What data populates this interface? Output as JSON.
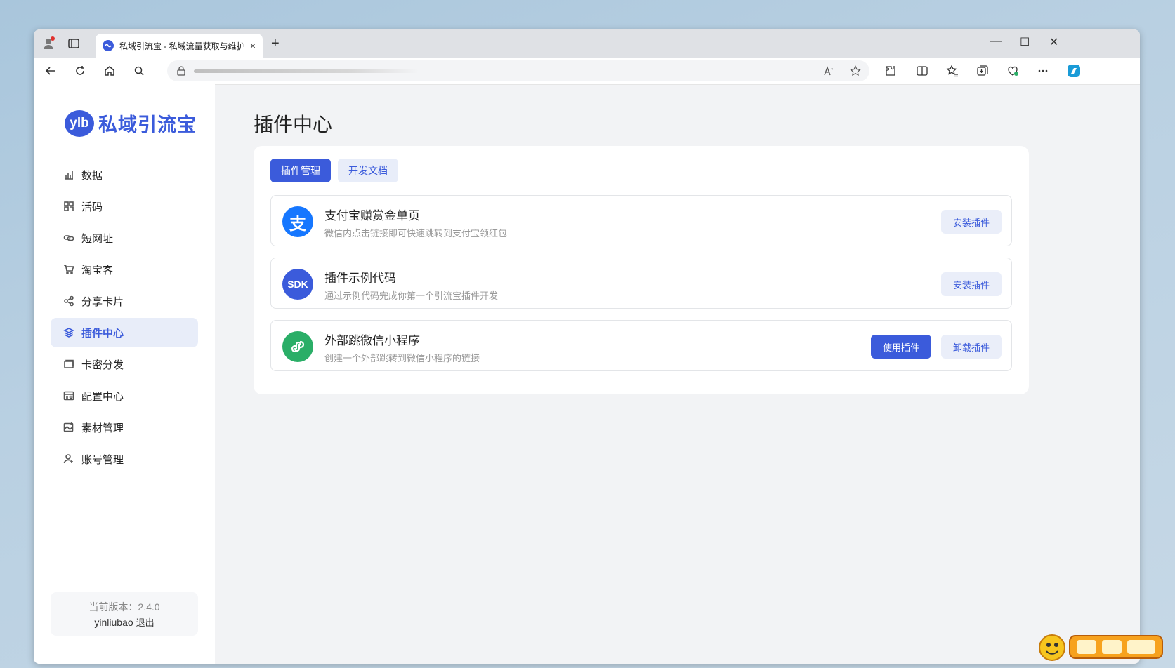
{
  "browser": {
    "tab_title": "私域引流宝 - 私域流量获取与维护",
    "new_tab_symbol": "+",
    "close_symbol": "×",
    "minimize_symbol": "—",
    "maximize_symbol": "☐",
    "window_close_symbol": "✕"
  },
  "app": {
    "logo_badge": "ylb",
    "logo_name": "私域引流宝",
    "accent_color": "#3b5bdb"
  },
  "sidebar": {
    "items": [
      {
        "label": "数据",
        "icon": "bar-chart-icon"
      },
      {
        "label": "活码",
        "icon": "grid-icon"
      },
      {
        "label": "短网址",
        "icon": "link-icon"
      },
      {
        "label": "淘宝客",
        "icon": "cart-icon"
      },
      {
        "label": "分享卡片",
        "icon": "share-icon"
      },
      {
        "label": "插件中心",
        "icon": "layers-icon",
        "active": true
      },
      {
        "label": "卡密分发",
        "icon": "card-icon"
      },
      {
        "label": "配置中心",
        "icon": "config-icon"
      },
      {
        "label": "素材管理",
        "icon": "image-icon"
      },
      {
        "label": "账号管理",
        "icon": "user-icon"
      }
    ],
    "version_label": "当前版本：2.4.0",
    "username": "yinliubao",
    "logout_label": "退出"
  },
  "main": {
    "title": "插件中心",
    "tabs": [
      {
        "label": "插件管理",
        "active": true
      },
      {
        "label": "开发文档",
        "active": false
      }
    ],
    "plugins": [
      {
        "name": "支付宝赚赏金单页",
        "description": "微信内点击链接即可快速跳转到支付宝领红包",
        "icon": "alipay-icon",
        "icon_text": "支",
        "icon_color": "#1677ff",
        "actions": [
          {
            "label": "安装插件",
            "style": "light"
          }
        ]
      },
      {
        "name": "插件示例代码",
        "description": "通过示例代码完成你第一个引流宝插件开发",
        "icon": "sdk-icon",
        "icon_text": "SDK",
        "icon_color": "#3b5bdb",
        "actions": [
          {
            "label": "安装插件",
            "style": "light"
          }
        ]
      },
      {
        "name": "外部跳微信小程序",
        "description": "创建一个外部跳转到微信小程序的链接",
        "icon": "wechat-miniprogram-icon",
        "icon_text": "",
        "icon_color": "#2aae67",
        "actions": [
          {
            "label": "使用插件",
            "style": "primary"
          },
          {
            "label": "卸载插件",
            "style": "light"
          }
        ]
      }
    ]
  }
}
